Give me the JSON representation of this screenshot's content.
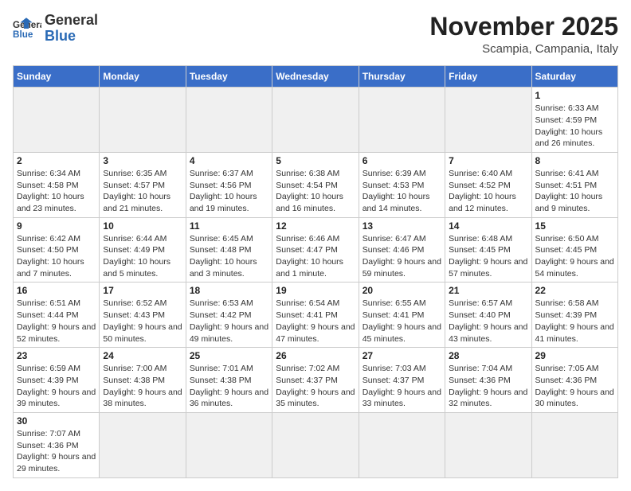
{
  "header": {
    "logo_general": "General",
    "logo_blue": "Blue",
    "month_title": "November 2025",
    "location": "Scampia, Campania, Italy"
  },
  "weekdays": [
    "Sunday",
    "Monday",
    "Tuesday",
    "Wednesday",
    "Thursday",
    "Friday",
    "Saturday"
  ],
  "weeks": [
    [
      {
        "day": "",
        "empty": true
      },
      {
        "day": "",
        "empty": true
      },
      {
        "day": "",
        "empty": true
      },
      {
        "day": "",
        "empty": true
      },
      {
        "day": "",
        "empty": true
      },
      {
        "day": "",
        "empty": true
      },
      {
        "day": "1",
        "sunrise": "6:33 AM",
        "sunset": "4:59 PM",
        "daylight": "10 hours and 26 minutes."
      }
    ],
    [
      {
        "day": "2",
        "sunrise": "6:34 AM",
        "sunset": "4:58 PM",
        "daylight": "10 hours and 23 minutes."
      },
      {
        "day": "3",
        "sunrise": "6:35 AM",
        "sunset": "4:57 PM",
        "daylight": "10 hours and 21 minutes."
      },
      {
        "day": "4",
        "sunrise": "6:37 AM",
        "sunset": "4:56 PM",
        "daylight": "10 hours and 19 minutes."
      },
      {
        "day": "5",
        "sunrise": "6:38 AM",
        "sunset": "4:54 PM",
        "daylight": "10 hours and 16 minutes."
      },
      {
        "day": "6",
        "sunrise": "6:39 AM",
        "sunset": "4:53 PM",
        "daylight": "10 hours and 14 minutes."
      },
      {
        "day": "7",
        "sunrise": "6:40 AM",
        "sunset": "4:52 PM",
        "daylight": "10 hours and 12 minutes."
      },
      {
        "day": "8",
        "sunrise": "6:41 AM",
        "sunset": "4:51 PM",
        "daylight": "10 hours and 9 minutes."
      }
    ],
    [
      {
        "day": "9",
        "sunrise": "6:42 AM",
        "sunset": "4:50 PM",
        "daylight": "10 hours and 7 minutes."
      },
      {
        "day": "10",
        "sunrise": "6:44 AM",
        "sunset": "4:49 PM",
        "daylight": "10 hours and 5 minutes."
      },
      {
        "day": "11",
        "sunrise": "6:45 AM",
        "sunset": "4:48 PM",
        "daylight": "10 hours and 3 minutes."
      },
      {
        "day": "12",
        "sunrise": "6:46 AM",
        "sunset": "4:47 PM",
        "daylight": "10 hours and 1 minute."
      },
      {
        "day": "13",
        "sunrise": "6:47 AM",
        "sunset": "4:46 PM",
        "daylight": "9 hours and 59 minutes."
      },
      {
        "day": "14",
        "sunrise": "6:48 AM",
        "sunset": "4:45 PM",
        "daylight": "9 hours and 57 minutes."
      },
      {
        "day": "15",
        "sunrise": "6:50 AM",
        "sunset": "4:45 PM",
        "daylight": "9 hours and 54 minutes."
      }
    ],
    [
      {
        "day": "16",
        "sunrise": "6:51 AM",
        "sunset": "4:44 PM",
        "daylight": "9 hours and 52 minutes."
      },
      {
        "day": "17",
        "sunrise": "6:52 AM",
        "sunset": "4:43 PM",
        "daylight": "9 hours and 50 minutes."
      },
      {
        "day": "18",
        "sunrise": "6:53 AM",
        "sunset": "4:42 PM",
        "daylight": "9 hours and 49 minutes."
      },
      {
        "day": "19",
        "sunrise": "6:54 AM",
        "sunset": "4:41 PM",
        "daylight": "9 hours and 47 minutes."
      },
      {
        "day": "20",
        "sunrise": "6:55 AM",
        "sunset": "4:41 PM",
        "daylight": "9 hours and 45 minutes."
      },
      {
        "day": "21",
        "sunrise": "6:57 AM",
        "sunset": "4:40 PM",
        "daylight": "9 hours and 43 minutes."
      },
      {
        "day": "22",
        "sunrise": "6:58 AM",
        "sunset": "4:39 PM",
        "daylight": "9 hours and 41 minutes."
      }
    ],
    [
      {
        "day": "23",
        "sunrise": "6:59 AM",
        "sunset": "4:39 PM",
        "daylight": "9 hours and 39 minutes."
      },
      {
        "day": "24",
        "sunrise": "7:00 AM",
        "sunset": "4:38 PM",
        "daylight": "9 hours and 38 minutes."
      },
      {
        "day": "25",
        "sunrise": "7:01 AM",
        "sunset": "4:38 PM",
        "daylight": "9 hours and 36 minutes."
      },
      {
        "day": "26",
        "sunrise": "7:02 AM",
        "sunset": "4:37 PM",
        "daylight": "9 hours and 35 minutes."
      },
      {
        "day": "27",
        "sunrise": "7:03 AM",
        "sunset": "4:37 PM",
        "daylight": "9 hours and 33 minutes."
      },
      {
        "day": "28",
        "sunrise": "7:04 AM",
        "sunset": "4:36 PM",
        "daylight": "9 hours and 32 minutes."
      },
      {
        "day": "29",
        "sunrise": "7:05 AM",
        "sunset": "4:36 PM",
        "daylight": "9 hours and 30 minutes."
      }
    ],
    [
      {
        "day": "30",
        "sunrise": "7:07 AM",
        "sunset": "4:36 PM",
        "daylight": "9 hours and 29 minutes.",
        "lastrow": true
      },
      {
        "day": "",
        "empty": true,
        "lastrow": true
      },
      {
        "day": "",
        "empty": true,
        "lastrow": true
      },
      {
        "day": "",
        "empty": true,
        "lastrow": true
      },
      {
        "day": "",
        "empty": true,
        "lastrow": true
      },
      {
        "day": "",
        "empty": true,
        "lastrow": true
      },
      {
        "day": "",
        "empty": true,
        "lastrow": true
      }
    ]
  ],
  "labels": {
    "sunrise_label": "Sunrise:",
    "sunset_label": "Sunset:",
    "daylight_label": "Daylight:"
  }
}
